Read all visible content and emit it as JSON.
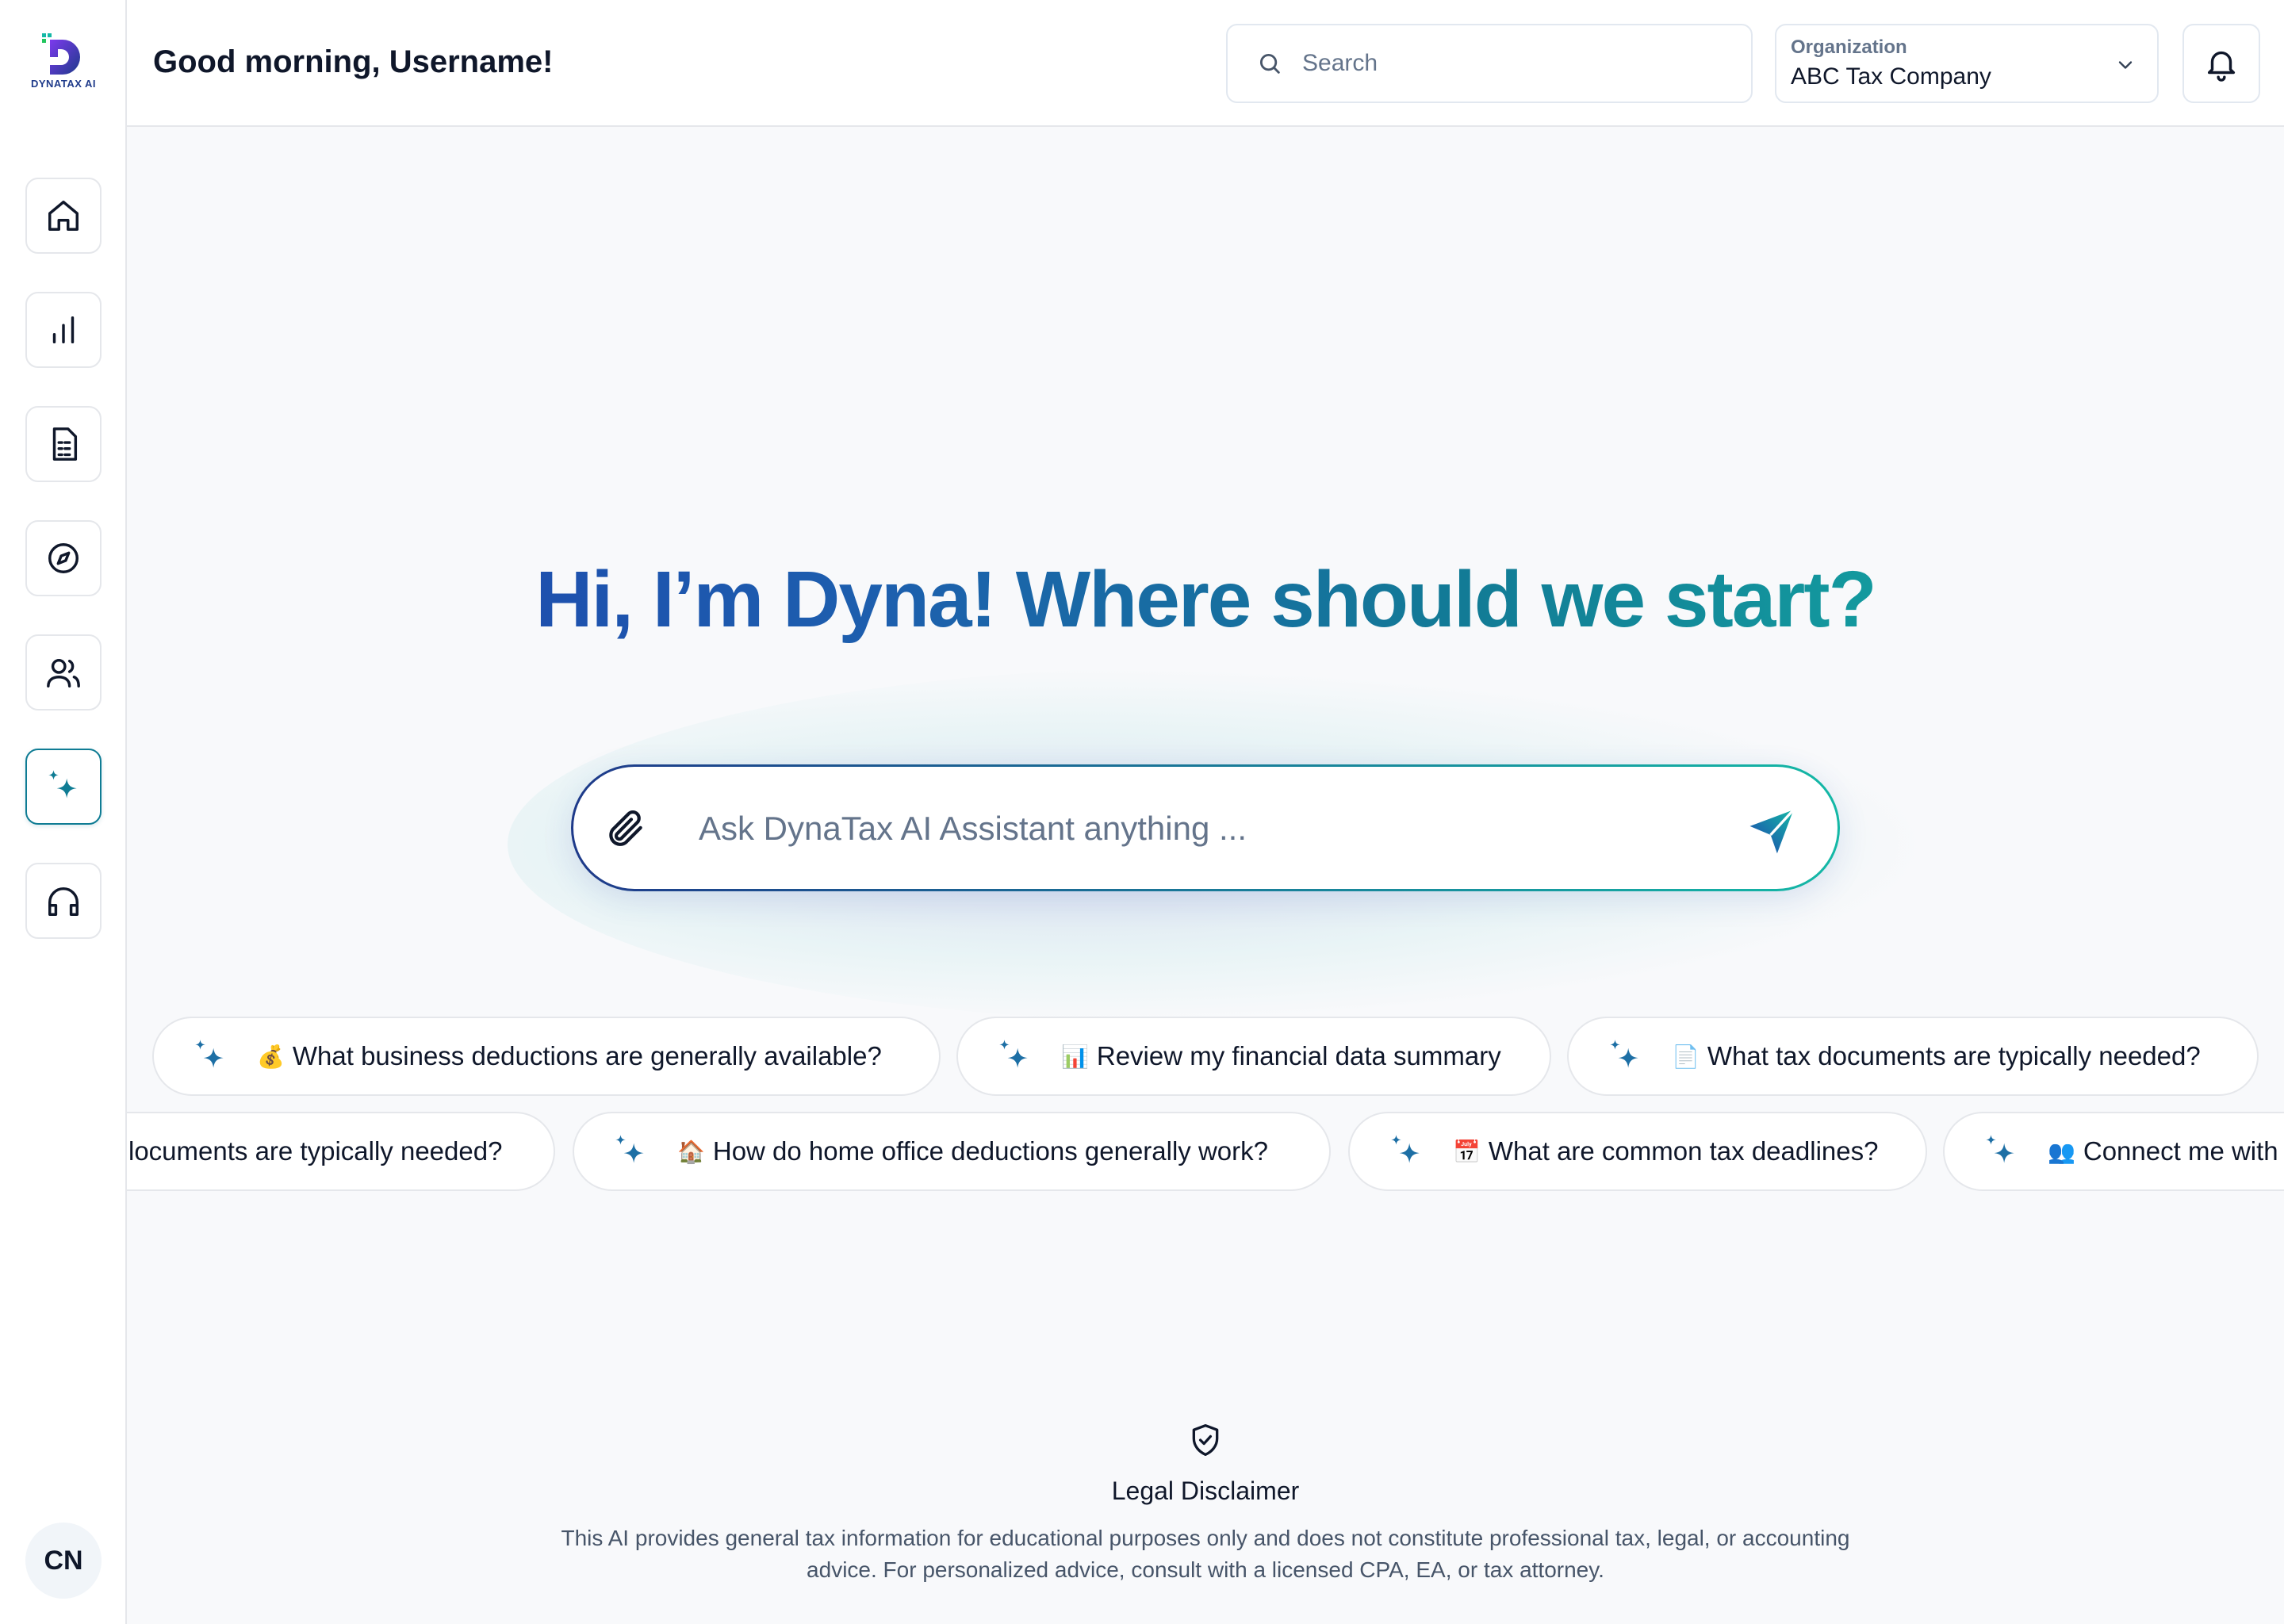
{
  "brand": {
    "logo_text": "DYNATAX AI"
  },
  "header": {
    "greeting": "Good morning, Username!",
    "search_placeholder": "Search",
    "org_label": "Organization",
    "org_value": "ABC Tax Company"
  },
  "sidebar": {
    "items": [
      {
        "icon": "home-icon"
      },
      {
        "icon": "bar-chart-icon"
      },
      {
        "icon": "document-icon"
      },
      {
        "icon": "compass-icon"
      },
      {
        "icon": "users-icon"
      },
      {
        "icon": "sparkle-icon",
        "active": true
      },
      {
        "icon": "headphones-icon"
      }
    ],
    "avatar_initials": "CN"
  },
  "hero": {
    "title": "Hi, I’m Dyna! Where should we start?",
    "input_placeholder": "Ask DynaTax AI Assistant anything ..."
  },
  "suggestions_row1": [
    {
      "emoji": "💰",
      "text": "What business deductions are generally available?"
    },
    {
      "emoji": "📊",
      "text": "Review my financial data summary"
    },
    {
      "emoji": "📄",
      "text": "What tax documents are typically needed?"
    }
  ],
  "suggestions_row2": [
    {
      "emoji": "",
      "text": "locuments are typically needed?"
    },
    {
      "emoji": "🏠",
      "text": "How do home office deductions generally work?"
    },
    {
      "emoji": "📅",
      "text": "What are common tax deadlines?"
    },
    {
      "emoji": "👥",
      "text": "Connect me with"
    }
  ],
  "disclaimer": {
    "title": "Legal Disclaimer",
    "text": "This AI provides general tax information for educational purposes only and does not constitute professional tax, legal, or accounting advice. For personalized advice, consult with a licensed CPA, EA, or tax attorney."
  },
  "colors": {
    "gradient_start": "#1e40af",
    "gradient_end": "#14b8a6",
    "accent": "#0f7c94"
  }
}
